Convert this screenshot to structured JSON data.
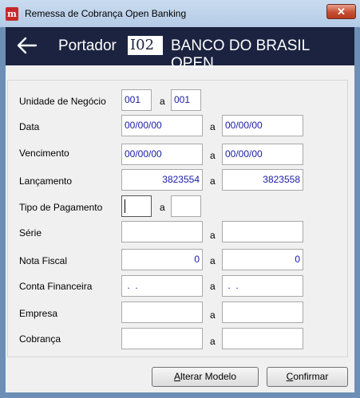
{
  "window": {
    "title": "Remessa de Cobrança Open Banking",
    "close_label": "✕",
    "icon_letter": "m"
  },
  "header": {
    "label": "Portador",
    "code": "I02",
    "bank_name": "BANCO DO BRASIL OPEN"
  },
  "separator": "a",
  "rows": [
    {
      "label": "Unidade de Negócio",
      "from": "001",
      "to": "001"
    },
    {
      "label": "Data",
      "from": "00/00/00",
      "to": "00/00/00"
    },
    {
      "label": "Vencimento",
      "from": "00/00/00",
      "to": "00/00/00"
    },
    {
      "label": "Lançamento",
      "from": "3823554",
      "to": "3823558"
    },
    {
      "label": "Tipo de Pagamento",
      "from": "",
      "to": ""
    },
    {
      "label": "Série",
      "from": "",
      "to": ""
    },
    {
      "label": "Nota Fiscal",
      "from": "0",
      "to": "0"
    },
    {
      "label": "Conta Financeira",
      "from": " .  .",
      "to": " .  ."
    },
    {
      "label": "Empresa",
      "from": "",
      "to": ""
    },
    {
      "label": "Cobrança",
      "from": "",
      "to": ""
    }
  ],
  "buttons": {
    "alterar_first": "A",
    "alterar_rest": "lterar Modelo",
    "confirmar_first": "C",
    "confirmar_rest": "onfirmar"
  }
}
